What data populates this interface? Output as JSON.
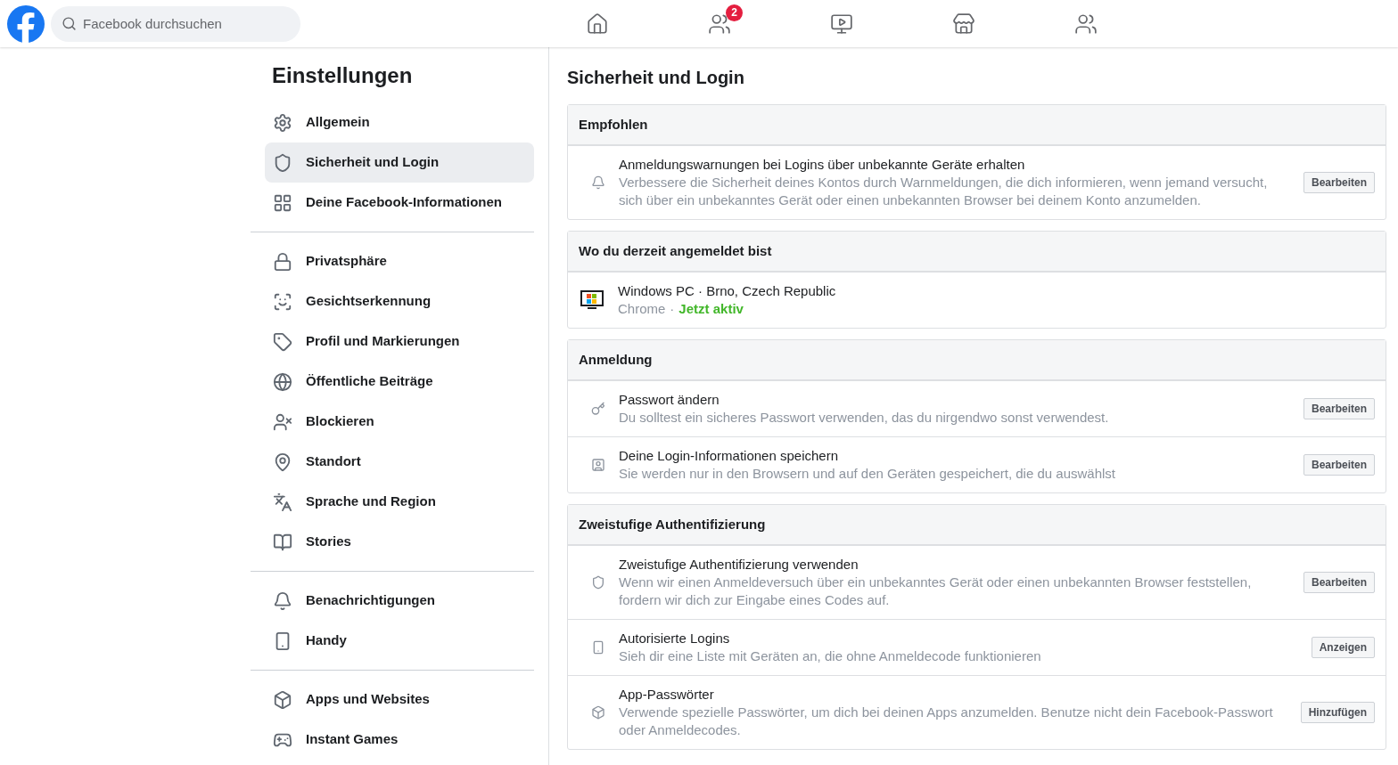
{
  "header": {
    "search": {
      "placeholder": "Facebook durchsuchen"
    },
    "nav": [
      {
        "selected": false
      },
      {
        "selected": false,
        "badge": "2"
      },
      {
        "selected": false
      },
      {
        "selected": false
      },
      {
        "selected": false
      }
    ]
  },
  "sidebar": {
    "title": "Einstellungen",
    "groups": [
      [
        {
          "label": "Allgemein",
          "selected": false
        },
        {
          "label": "Sicherheit und Login",
          "selected": true
        },
        {
          "label": "Deine Facebook-Informationen",
          "selected": false
        }
      ],
      [
        {
          "label": "Privatsphäre",
          "selected": false
        },
        {
          "label": "Gesichtserkennung",
          "selected": false
        },
        {
          "label": "Profil und Markierungen",
          "selected": false
        },
        {
          "label": "Öffentliche Beiträge",
          "selected": false
        },
        {
          "label": "Blockieren",
          "selected": false
        },
        {
          "label": "Standort",
          "selected": false
        },
        {
          "label": "Sprache und Region",
          "selected": false
        },
        {
          "label": "Stories",
          "selected": false
        }
      ],
      [
        {
          "label": "Benachrichtigungen",
          "selected": false
        },
        {
          "label": "Handy",
          "selected": false
        }
      ],
      [
        {
          "label": "Apps und Websites",
          "selected": false
        },
        {
          "label": "Instant Games",
          "selected": false
        }
      ]
    ]
  },
  "main": {
    "title": "Sicherheit und Login",
    "sections": [
      {
        "title": "Empfohlen",
        "rows": [
          {
            "kind": "setting",
            "title": "Anmeldungswarnungen bei Logins über unbekannte Geräte erhalten",
            "description": "Verbessere die Sicherheit deines Kontos durch Warnmeldungen, die dich informieren, wenn jemand versucht, sich über ein unbekanntes Gerät oder einen unbekannten Browser bei deinem Konto anzumelden.",
            "button": "Bearbeiten"
          }
        ]
      },
      {
        "title": "Wo du derzeit angemeldet bist",
        "rows": [
          {
            "kind": "session",
            "title": "Windows PC · Brno, Czech Republic",
            "browser": "Chrome",
            "separator": "·",
            "status": "Jetzt aktiv"
          }
        ]
      },
      {
        "title": "Anmeldung",
        "rows": [
          {
            "kind": "setting",
            "title": "Passwort ändern",
            "description": "Du solltest ein sicheres Passwort verwenden, das du nirgendwo sonst verwendest.",
            "button": "Bearbeiten"
          },
          {
            "kind": "setting",
            "title": "Deine Login-Informationen speichern",
            "description": "Sie werden nur in den Browsern und auf den Geräten gespeichert, die du auswählst",
            "button": "Bearbeiten"
          }
        ]
      },
      {
        "title": "Zweistufige Authentifizierung",
        "rows": [
          {
            "kind": "setting",
            "title": "Zweistufige Authentifizierung verwenden",
            "description": "Wenn wir einen Anmeldeversuch über ein unbekanntes Gerät oder einen unbekannten Browser feststellen, fordern wir dich zur Eingabe eines Codes auf.",
            "button": "Bearbeiten"
          },
          {
            "kind": "setting",
            "title": "Autorisierte Logins",
            "description": "Sieh dir eine Liste mit Geräten an, die ohne Anmeldecode funktionieren",
            "button": "Anzeigen"
          },
          {
            "kind": "setting",
            "title": "App-Passwörter",
            "description": "Verwende spezielle Passwörter, um dich bei deinen Apps anzumelden. Benutze nicht dein Facebook-Passwort oder Anmeldecodes.",
            "button": "Hinzufügen"
          }
        ]
      }
    ]
  }
}
